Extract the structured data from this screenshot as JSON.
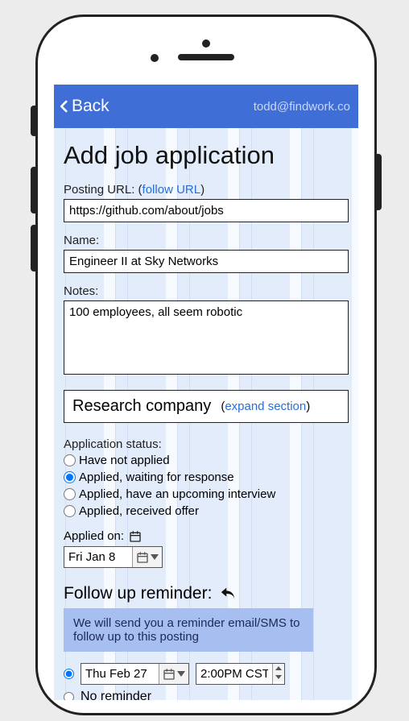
{
  "header": {
    "back_label": "Back",
    "email": "todd@findwork.co"
  },
  "page": {
    "title": "Add job application"
  },
  "posting_url": {
    "label": "Posting URL: (",
    "follow": "follow URL",
    "close": ")",
    "value": "https://github.com/about/jobs"
  },
  "name": {
    "label": "Name:",
    "value": "Engineer II at Sky Networks"
  },
  "notes": {
    "label": "Notes:",
    "value": "100 employees, all seem robotic"
  },
  "research": {
    "title": "Research company",
    "open": "(",
    "expand": "expand section",
    "close": ")"
  },
  "status": {
    "label": "Application status:",
    "options": [
      "Have not applied",
      "Applied, waiting for response",
      "Applied, have an upcoming interview",
      "Applied, received offer"
    ],
    "selected": 1
  },
  "applied": {
    "label": "Applied on:",
    "value": "Fri Jan 8"
  },
  "followup": {
    "title": "Follow up reminder:",
    "info": "We will send you a reminder email/SMS to follow up to this posting",
    "date": "Thu Feb 27",
    "time": "2:00PM CST",
    "no_reminder": "No reminder"
  }
}
